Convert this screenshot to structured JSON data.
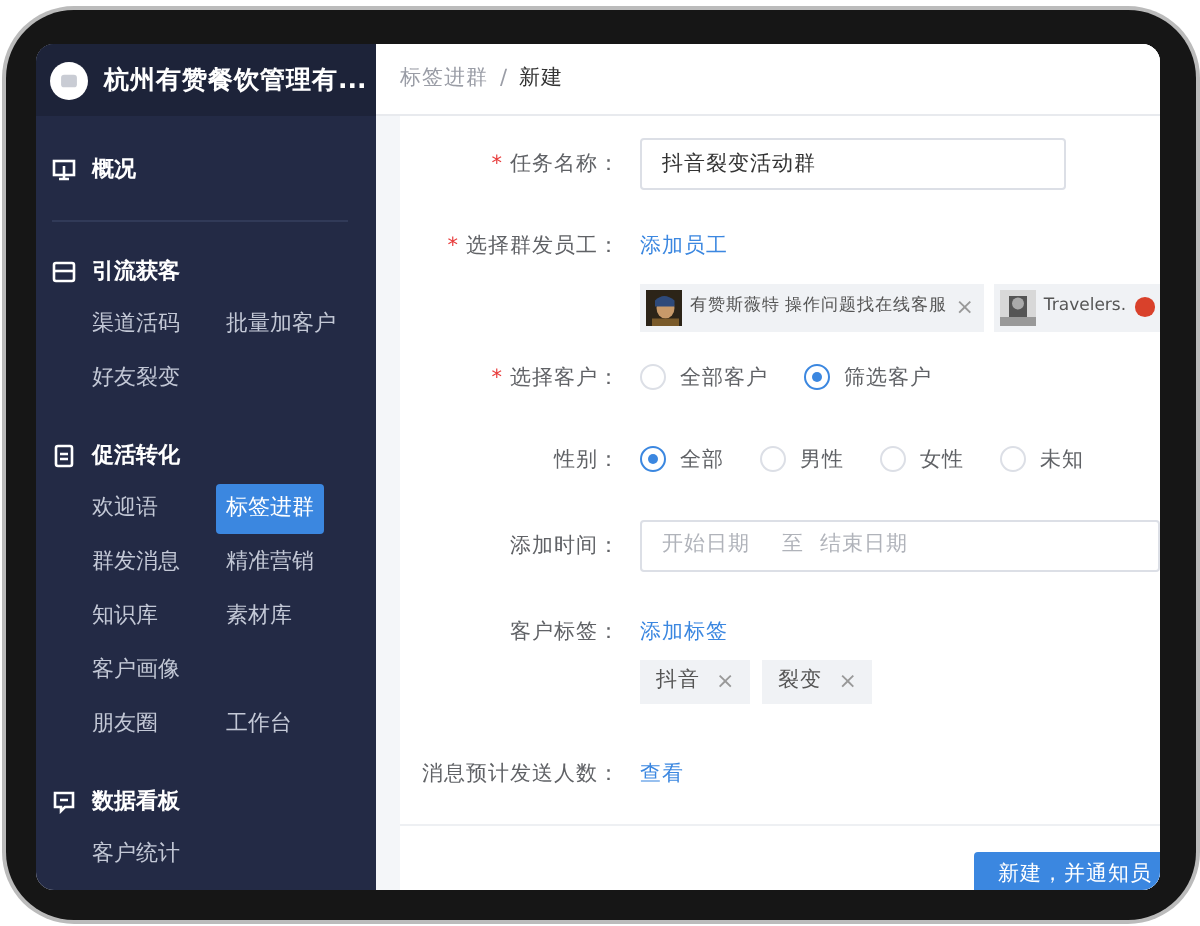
{
  "app": {
    "title": "杭州有赞餐饮管理有..."
  },
  "sidebar": {
    "sections": [
      {
        "title": "概况"
      },
      {
        "title": "引流获客",
        "rows": [
          [
            {
              "label": "渠道活码",
              "selected": false
            },
            {
              "label": "批量加客户",
              "selected": false
            }
          ],
          [
            {
              "label": "好友裂变",
              "selected": false
            }
          ]
        ]
      },
      {
        "title": "促活转化",
        "rows": [
          [
            {
              "label": "欢迎语",
              "selected": false
            },
            {
              "label": "标签进群",
              "selected": true
            }
          ],
          [
            {
              "label": "群发消息",
              "selected": false
            },
            {
              "label": "精准营销",
              "selected": false
            }
          ],
          [
            {
              "label": "知识库",
              "selected": false
            },
            {
              "label": "素材库",
              "selected": false
            }
          ],
          [
            {
              "label": "客户画像",
              "selected": false
            }
          ],
          [
            {
              "label": "朋友圈",
              "selected": false
            },
            {
              "label": "工作台",
              "selected": false
            }
          ]
        ]
      },
      {
        "title": "数据看板",
        "rows": [
          [
            {
              "label": "客户统计",
              "selected": false
            }
          ]
        ]
      }
    ]
  },
  "breadcrumb": {
    "items": [
      "标签进群",
      "新建"
    ],
    "separator": "/"
  },
  "form": {
    "fields": [
      {
        "kind": "input",
        "label": "任务名称：",
        "required_mark": "*",
        "value": "抖音裂变活动群"
      },
      {
        "kind": "chips",
        "label": "选择群发员工：",
        "required_mark": "*",
        "link": "添加员工",
        "chips": [
          {
            "text": "有赞斯薇特 操作问题找在线客服",
            "remove": "×"
          },
          {
            "text": "Travelers."
          }
        ]
      },
      {
        "kind": "radio",
        "label": "选择客户：",
        "required_mark": "*",
        "options": [
          {
            "label": "全部客户",
            "selected": false
          },
          {
            "label": "筛选客户",
            "selected": true
          }
        ]
      },
      {
        "kind": "radio",
        "label": "性别：",
        "options": [
          {
            "label": "全部",
            "selected": true
          },
          {
            "label": "男性",
            "selected": false
          },
          {
            "label": "女性",
            "selected": false
          },
          {
            "label": "未知",
            "selected": false
          }
        ]
      },
      {
        "kind": "date_range",
        "label": "添加时间：",
        "start_placeholder": "开始日期",
        "separator": "至",
        "end_placeholder": "结束日期"
      },
      {
        "kind": "tags",
        "label": "客户标签：",
        "link": "添加标签",
        "tags": [
          {
            "text": "抖音",
            "remove": "×"
          },
          {
            "text": "裂变",
            "remove": "×"
          }
        ]
      },
      {
        "kind": "link",
        "label": "消息预计发送人数：",
        "link": "查看"
      }
    ]
  },
  "footer": {
    "button": "新建，并通知员"
  }
}
